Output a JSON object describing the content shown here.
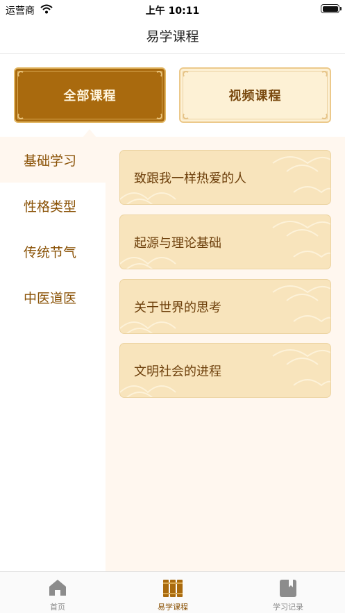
{
  "status_bar": {
    "carrier": "运营商",
    "time": "上午 10:11"
  },
  "nav": {
    "title": "易学课程"
  },
  "categories": [
    {
      "label": "全部课程",
      "active": true
    },
    {
      "label": "视频课程",
      "active": false
    }
  ],
  "sidebar": {
    "items": [
      {
        "label": "基础学习",
        "active": true
      },
      {
        "label": "性格类型",
        "active": false
      },
      {
        "label": "传统节气",
        "active": false
      },
      {
        "label": "中医道医",
        "active": false
      }
    ]
  },
  "courses": [
    {
      "label": "致跟我一样热爱的人"
    },
    {
      "label": "起源与理论基础"
    },
    {
      "label": "关于世界的思考"
    },
    {
      "label": "文明社会的进程"
    }
  ],
  "tab_bar": {
    "tabs": [
      {
        "label": "首页",
        "icon": "home-icon",
        "active": false
      },
      {
        "label": "易学课程",
        "icon": "books-icon",
        "active": true
      },
      {
        "label": "学习记录",
        "icon": "notebook-icon",
        "active": false
      }
    ]
  },
  "colors": {
    "accent": "#a96a0e",
    "text_brown": "#8a5206",
    "card_bg": "#f8e4bc",
    "panel_bg": "#fff7ef"
  }
}
